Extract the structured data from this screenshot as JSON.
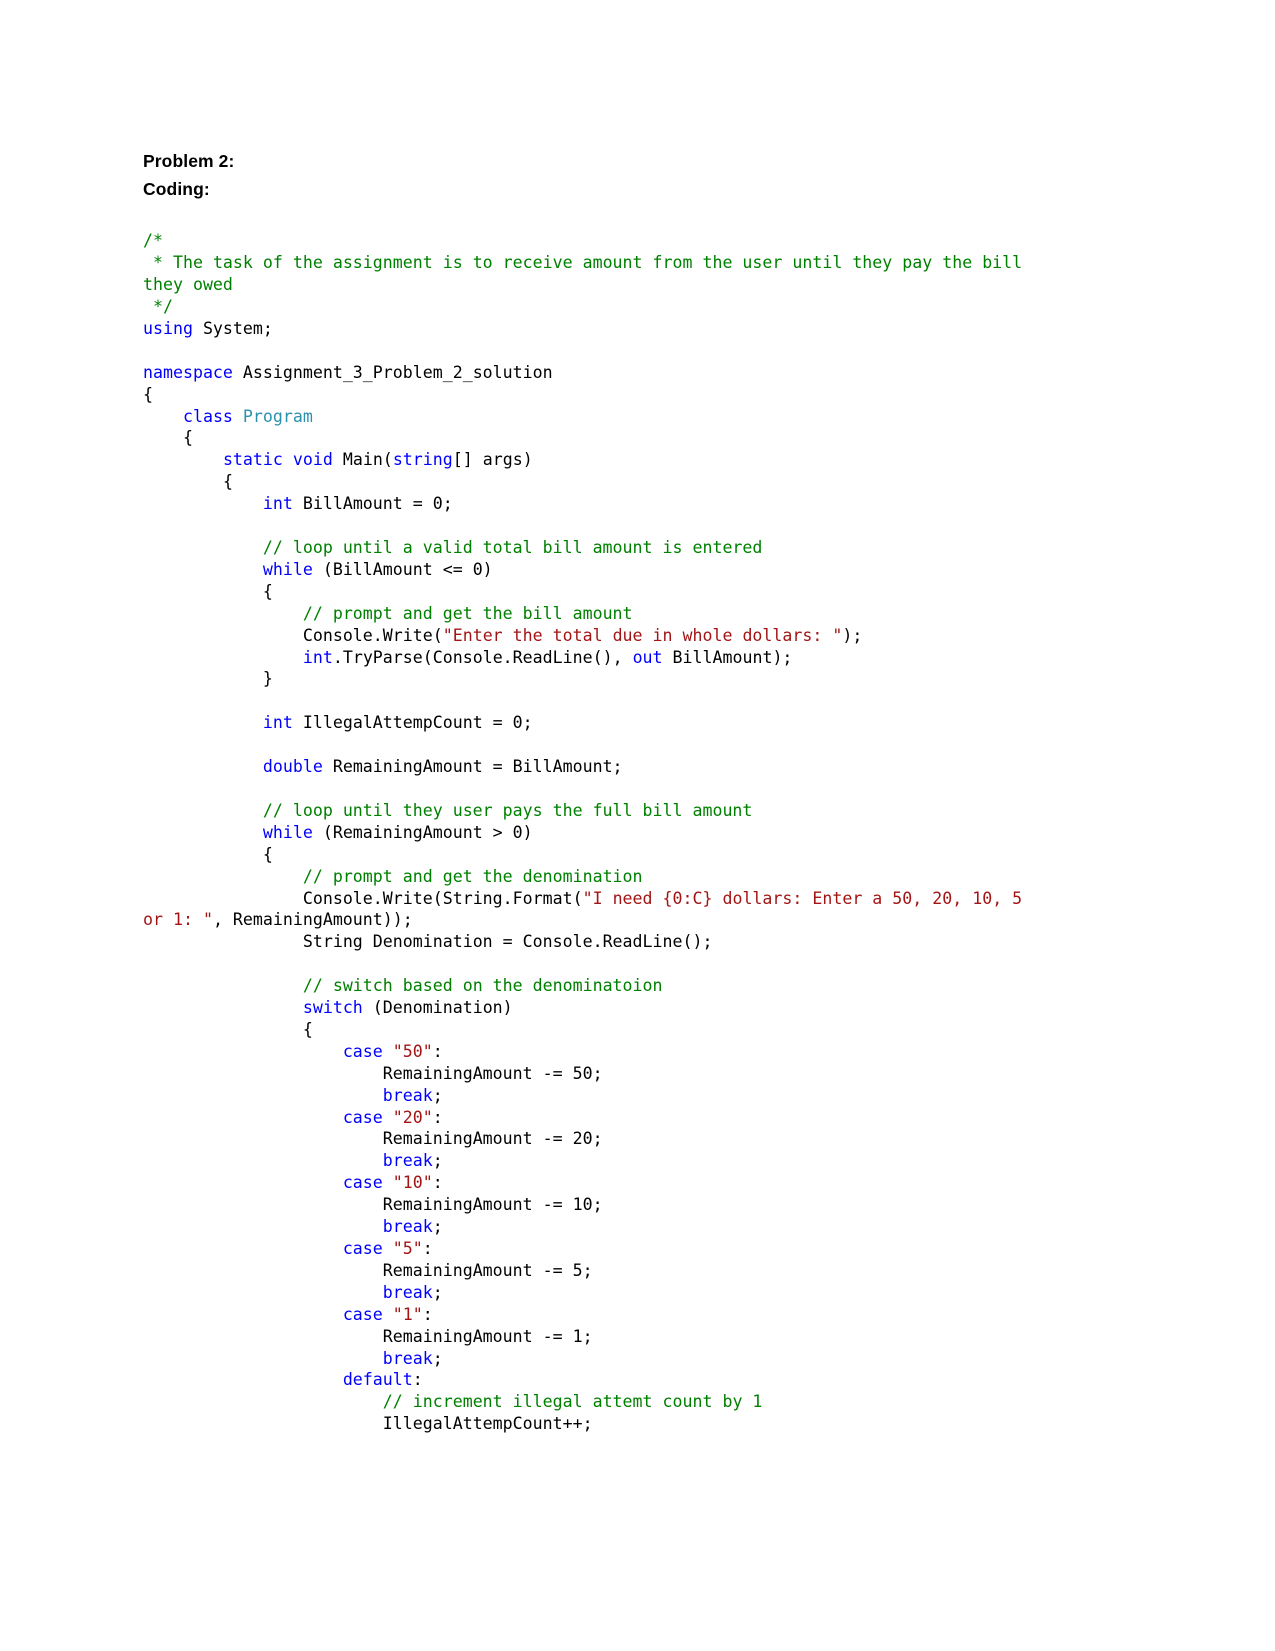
{
  "document": {
    "headings": [
      {
        "text": "Problem 2:"
      },
      {
        "text": "Coding:"
      }
    ],
    "language": "csharp",
    "colors": {
      "comment": "#008000",
      "keyword": "#0000ff",
      "type": "#2b91af",
      "string": "#a31515",
      "plain": "#000000",
      "background": "#ffffff"
    },
    "code_lines": [
      {
        "id": "l01",
        "text": "/*"
      },
      {
        "id": "l02",
        "text": " * The task of the assignment is to receive amount from the user until they pay the bill they owed"
      },
      {
        "id": "l03",
        "text": " */"
      },
      {
        "id": "l04",
        "text": "using System;"
      },
      {
        "id": "l05",
        "text": ""
      },
      {
        "id": "l06",
        "text": "namespace Assignment_3_Problem_2_solution"
      },
      {
        "id": "l07",
        "text": "{"
      },
      {
        "id": "l08",
        "text": "    class Program"
      },
      {
        "id": "l09",
        "text": "    {"
      },
      {
        "id": "l10",
        "text": "        static void Main(string[] args)"
      },
      {
        "id": "l11",
        "text": "        {"
      },
      {
        "id": "l12",
        "text": "            int BillAmount = 0;"
      },
      {
        "id": "l13",
        "text": ""
      },
      {
        "id": "l14",
        "text": "            // loop until a valid total bill amount is entered"
      },
      {
        "id": "l15",
        "text": "            while (BillAmount <= 0)"
      },
      {
        "id": "l16",
        "text": "            {"
      },
      {
        "id": "l17",
        "text": "                // prompt and get the bill amount"
      },
      {
        "id": "l18",
        "text": "                Console.Write(\"Enter the total due in whole dollars: \");"
      },
      {
        "id": "l19",
        "text": "                int.TryParse(Console.ReadLine(), out BillAmount);"
      },
      {
        "id": "l20",
        "text": "            }"
      },
      {
        "id": "l21",
        "text": ""
      },
      {
        "id": "l22",
        "text": "            int IllegalAttempCount = 0;"
      },
      {
        "id": "l23",
        "text": ""
      },
      {
        "id": "l24",
        "text": "            double RemainingAmount = BillAmount;"
      },
      {
        "id": "l25",
        "text": ""
      },
      {
        "id": "l26",
        "text": "            // loop until they user pays the full bill amount"
      },
      {
        "id": "l27",
        "text": "            while (RemainingAmount > 0)"
      },
      {
        "id": "l28",
        "text": "            {"
      },
      {
        "id": "l29",
        "text": "                // prompt and get the denomination"
      },
      {
        "id": "l30",
        "text": "                Console.Write(String.Format(\"I need {0:C} dollars: Enter a 50, 20, 10, 5 or 1: \", RemainingAmount));"
      },
      {
        "id": "l31",
        "text": "                String Denomination = Console.ReadLine();"
      },
      {
        "id": "l32",
        "text": ""
      },
      {
        "id": "l33",
        "text": "                // switch based on the denominatoion"
      },
      {
        "id": "l34",
        "text": "                switch (Denomination)"
      },
      {
        "id": "l35",
        "text": "                {"
      },
      {
        "id": "l36",
        "text": "                    case \"50\":"
      },
      {
        "id": "l37",
        "text": "                        RemainingAmount -= 50;"
      },
      {
        "id": "l38",
        "text": "                        break;"
      },
      {
        "id": "l39",
        "text": "                    case \"20\":"
      },
      {
        "id": "l40",
        "text": "                        RemainingAmount -= 20;"
      },
      {
        "id": "l41",
        "text": "                        break;"
      },
      {
        "id": "l42",
        "text": "                    case \"10\":"
      },
      {
        "id": "l43",
        "text": "                        RemainingAmount -= 10;"
      },
      {
        "id": "l44",
        "text": "                        break;"
      },
      {
        "id": "l45",
        "text": "                    case \"5\":"
      },
      {
        "id": "l46",
        "text": "                        RemainingAmount -= 5;"
      },
      {
        "id": "l47",
        "text": "                        break;"
      },
      {
        "id": "l48",
        "text": "                    case \"1\":"
      },
      {
        "id": "l49",
        "text": "                        RemainingAmount -= 1;"
      },
      {
        "id": "l50",
        "text": "                        break;"
      },
      {
        "id": "l51",
        "text": "                    default:"
      },
      {
        "id": "l52",
        "text": "                        // increment illegal attemt count by 1"
      },
      {
        "id": "l53",
        "text": "                        IllegalAttempCount++;"
      }
    ]
  }
}
